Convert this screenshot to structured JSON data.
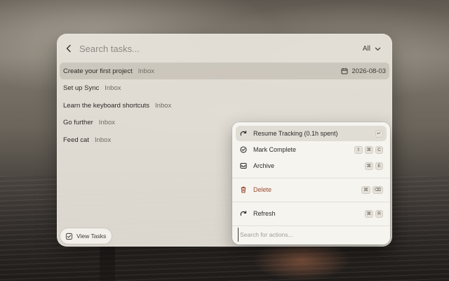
{
  "search": {
    "placeholder": "Search tasks..."
  },
  "filter": {
    "label": "All"
  },
  "tasks": [
    {
      "title": "Create your first project",
      "project": "Inbox",
      "date": "2026-08-03"
    },
    {
      "title": "Set up Sync",
      "project": "Inbox"
    },
    {
      "title": "Learn the keyboard shortcuts",
      "project": "Inbox"
    },
    {
      "title": "Go further",
      "project": "Inbox"
    },
    {
      "title": "Feed cat",
      "project": "Inbox"
    }
  ],
  "view_tasks": {
    "label": "View Tasks"
  },
  "actions": [
    {
      "label": "Resume Tracking (0.1h spent)",
      "icon": "resume-icon",
      "keys": [
        "↵"
      ]
    },
    {
      "label": "Mark Complete",
      "icon": "check-circle-icon",
      "keys": [
        "⇧",
        "⌘",
        "C"
      ]
    },
    {
      "label": "Archive",
      "icon": "archive-icon",
      "keys": [
        "⌘",
        "E"
      ]
    },
    {
      "label": "Delete",
      "icon": "trash-icon",
      "keys": [
        "⌘",
        "⌫"
      ]
    },
    {
      "label": "Refresh",
      "icon": "refresh-icon",
      "keys": [
        "⌘",
        "R"
      ]
    }
  ],
  "action_search": {
    "placeholder": "Search for actions..."
  },
  "colors": {
    "danger": "#9a4a32",
    "selected_row": "#c4bfb5"
  }
}
